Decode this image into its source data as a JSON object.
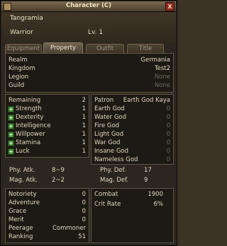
{
  "window": {
    "title": "Character (C)",
    "close_glyph": "X"
  },
  "character": {
    "name": "Tangramia",
    "class": "Warrior",
    "level": "Lv. 1"
  },
  "tabs": [
    {
      "label": "Equipment",
      "active": false
    },
    {
      "label": "Property",
      "active": true
    },
    {
      "label": "Outfit",
      "active": false
    },
    {
      "label": "Title",
      "active": false
    }
  ],
  "info": [
    {
      "label": "Realm",
      "value": "Germania",
      "dim": false
    },
    {
      "label": "Kingdom",
      "value": "Test2",
      "dim": false
    },
    {
      "label": "Legion",
      "value": "None",
      "dim": true
    },
    {
      "label": "Guild",
      "value": "None",
      "dim": true
    }
  ],
  "stats": {
    "remaining_label": "Remaining",
    "remaining_value": "2",
    "items": [
      {
        "label": "Strength",
        "value": "1"
      },
      {
        "label": "Dexterity",
        "value": "1"
      },
      {
        "label": "Intelligence",
        "value": "1"
      },
      {
        "label": "Willpower",
        "value": "1"
      },
      {
        "label": "Stamina",
        "value": "1"
      },
      {
        "label": "Luck",
        "value": "1"
      }
    ]
  },
  "gods": {
    "patron_label": "Patron",
    "patron_value": "Earth God Kaya",
    "items": [
      {
        "label": "Earth God",
        "value": "0"
      },
      {
        "label": "Water God",
        "value": "0"
      },
      {
        "label": "Fire God",
        "value": "0"
      },
      {
        "label": "Light God",
        "value": "0"
      },
      {
        "label": "War God",
        "value": "0"
      },
      {
        "label": "Insane God",
        "value": "0"
      },
      {
        "label": "Nameless God",
        "value": "0"
      }
    ]
  },
  "combat_stats": {
    "phy_atk_label": "Phy. Atk.",
    "phy_atk_value": "8~9",
    "mag_atk_label": "Mag. Atk.",
    "mag_atk_value": "2~2",
    "phy_def_label": "Phy. Def.",
    "phy_def_value": "17",
    "mag_def_label": "Mag. Def.",
    "mag_def_value": "9"
  },
  "reputation": [
    {
      "label": "Notoriety",
      "value": "0"
    },
    {
      "label": "Adventure",
      "value": "0"
    },
    {
      "label": "Grace",
      "value": "0"
    },
    {
      "label": "Merit",
      "value": "0"
    },
    {
      "label": "Peerage",
      "value": "Commoner"
    },
    {
      "label": "Ranking",
      "value": "51"
    }
  ],
  "combat": [
    {
      "label": "Combat",
      "value": "1900"
    },
    {
      "label": "Crit Rate",
      "value": "6%"
    }
  ]
}
